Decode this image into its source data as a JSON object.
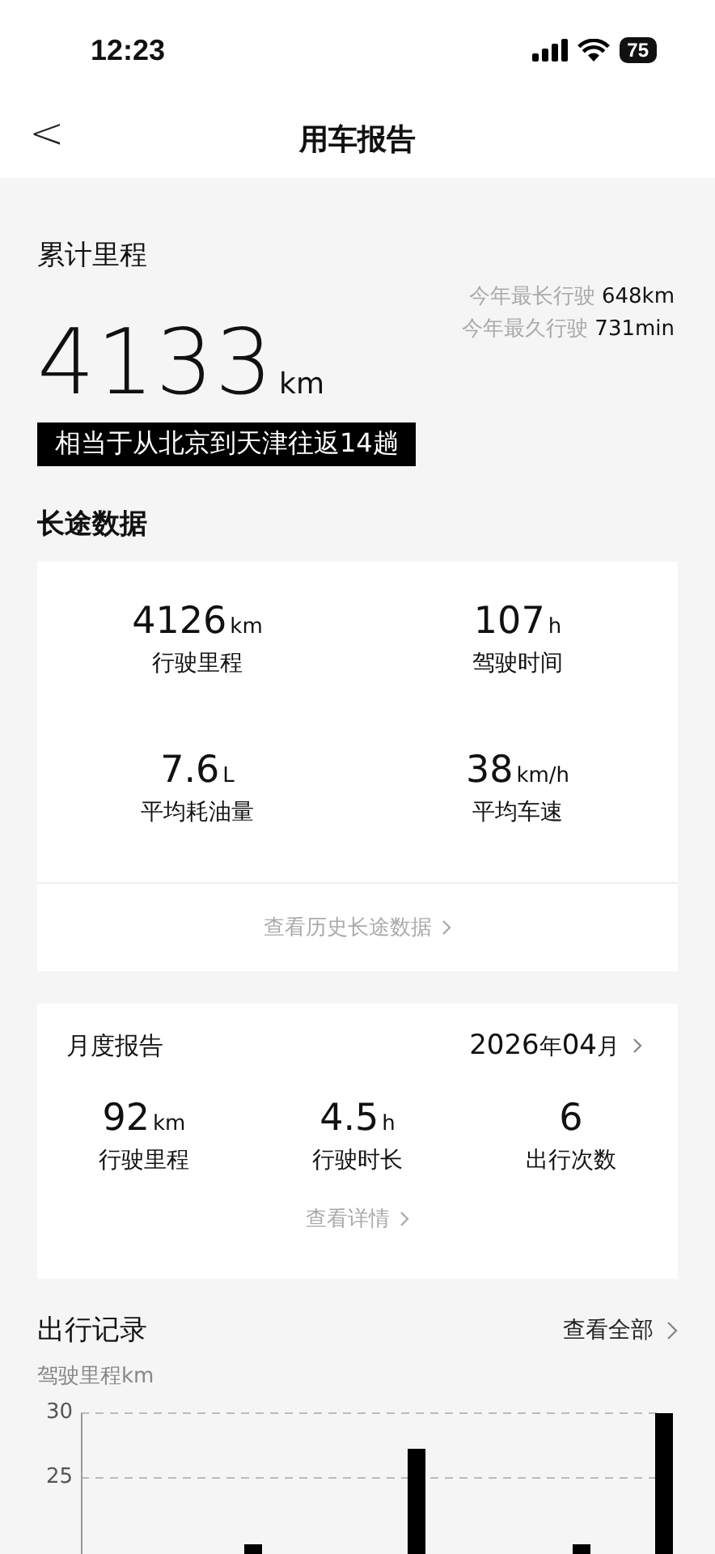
{
  "status_bar": {
    "time": "12:23",
    "battery": "75"
  },
  "header": {
    "back": "<",
    "title": "用车报告"
  },
  "total": {
    "label": "累计里程",
    "records": [
      {
        "label": "今年最长行驶",
        "value": "648km"
      },
      {
        "label": "今年最久行驶",
        "value": "731min"
      }
    ],
    "value": "4133",
    "unit": "km",
    "banner": "相当于从北京到天津往返14趟"
  },
  "long_trip": {
    "title": "长途数据",
    "stats": [
      {
        "value": "4126",
        "unit": "km",
        "label": "行驶里程"
      },
      {
        "value": "107",
        "unit": "h",
        "label": "驾驶时间"
      },
      {
        "value": "7.6",
        "unit": "L",
        "label": "平均耗油量"
      },
      {
        "value": "38",
        "unit": "km/h",
        "label": "平均车速"
      }
    ],
    "link": "查看历史长途数据"
  },
  "monthly": {
    "title": "月度报告",
    "year": "2026",
    "year_unit": "年",
    "month": "04",
    "month_unit": "月",
    "stats": [
      {
        "value": "92",
        "unit": "km",
        "label": "行驶里程"
      },
      {
        "value": "4.5",
        "unit": "h",
        "label": "行驶时长"
      },
      {
        "value": "6",
        "label": "出行次数"
      }
    ],
    "link": "查看详情"
  },
  "trips": {
    "title": "出行记录",
    "link": "查看全部",
    "ylabel": "驾驶里程km",
    "yticks": [
      "30",
      "25"
    ]
  }
}
